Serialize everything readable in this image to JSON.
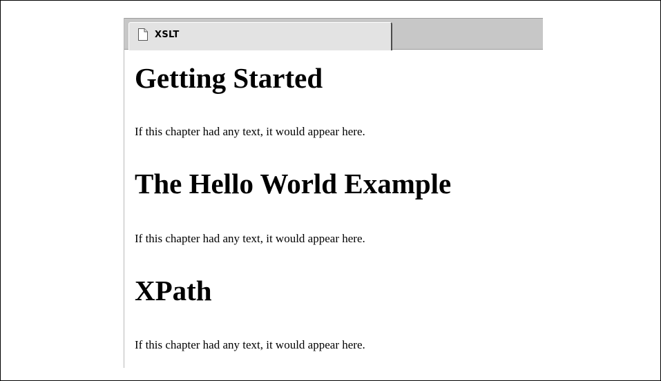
{
  "tabs": [
    {
      "label": "XSLT",
      "icon": "document-icon"
    }
  ],
  "content": {
    "sections": [
      {
        "heading": "Getting Started",
        "text": "If this chapter had any text, it would appear here."
      },
      {
        "heading": "The Hello World Example",
        "text": "If this chapter had any text, it would appear here."
      },
      {
        "heading": "XPath",
        "text": "If this chapter had any text, it would appear here."
      }
    ]
  }
}
